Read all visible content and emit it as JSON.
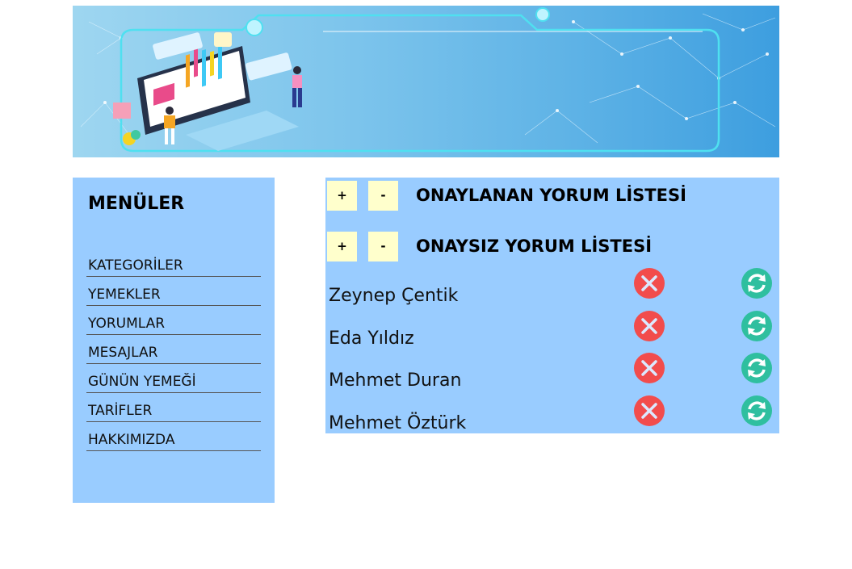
{
  "sidebar": {
    "title": "MENÜLER",
    "items": [
      {
        "label": "KATEGORİLER"
      },
      {
        "label": "YEMEKLER"
      },
      {
        "label": "YORUMLAR"
      },
      {
        "label": "MESAJLAR"
      },
      {
        "label": "GÜNÜN YEMEĞİ"
      },
      {
        "label": "TARİFLER"
      },
      {
        "label": "HAKKIMIZDA"
      }
    ]
  },
  "main": {
    "approved": {
      "title": "ONAYLANAN YORUM LİSTESİ",
      "plus": "+",
      "minus": "-"
    },
    "unapproved": {
      "title": "ONAYSIZ YORUM LİSTESİ",
      "plus": "+",
      "minus": "-"
    },
    "comments": [
      {
        "name": "Zeynep Çentik"
      },
      {
        "name": "Eda Yıldız"
      },
      {
        "name": "Mehmet Duran"
      },
      {
        "name": "Mehmet Öztürk"
      }
    ],
    "icons": {
      "delete": "close-circle-icon",
      "update": "refresh-circle-icon"
    }
  },
  "colors": {
    "panel": "#99ccff",
    "button": "#ffffcc",
    "delete": "#f24c4c",
    "update": "#2fbf9f"
  }
}
